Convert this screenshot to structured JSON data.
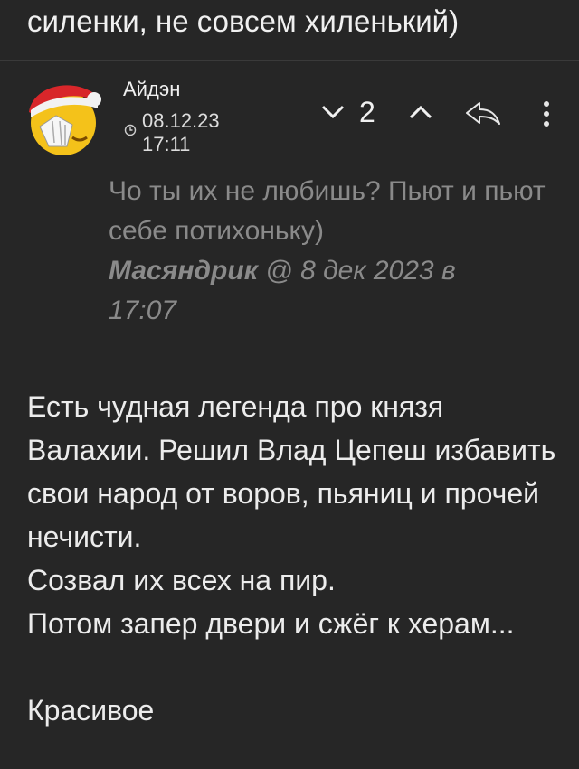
{
  "previous_comment": {
    "text": "силенки, не совсем хиленький)"
  },
  "comment": {
    "author": "Айдэн",
    "date": "08.12.23",
    "time": "17:11",
    "score": "2",
    "quote": {
      "text": "Чо ты их не любишь? Пьют и пьют себе потихоньку)",
      "author": "Масяндрик",
      "at": "@",
      "date_prefix": "8 дек 2023 в",
      "time": "17:07"
    },
    "body": [
      "Есть чудная легенда про князя Валахии. Решил Влад Цепеш избавить свои народ от воров, пьяниц и прочей нечисти.",
      "Созвал их всех на пир.",
      "Потом запер двери и сжёг к херам...",
      "",
      "Красивое"
    ]
  }
}
